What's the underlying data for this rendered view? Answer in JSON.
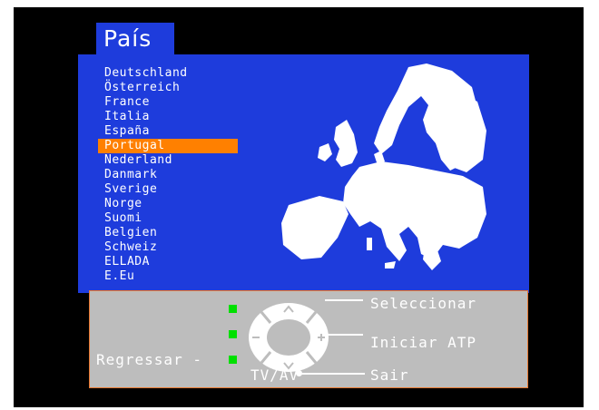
{
  "title": "País",
  "countries": [
    {
      "label": "Deutschland"
    },
    {
      "label": "Österreich"
    },
    {
      "label": "France"
    },
    {
      "label": "Italia"
    },
    {
      "label": "España"
    },
    {
      "label": "Portugal",
      "selected": true
    },
    {
      "label": "Nederland"
    },
    {
      "label": "Danmark"
    },
    {
      "label": "Sverige"
    },
    {
      "label": "Norge"
    },
    {
      "label": "Suomi"
    },
    {
      "label": "Belgien"
    },
    {
      "label": "Schweiz"
    },
    {
      "label": "ELLADA"
    },
    {
      "label": "E.Eu"
    }
  ],
  "controls": {
    "select_label": "Seleccionar",
    "start_label": "Iniciar ATP",
    "back_label": "Regressar -",
    "source_label": "TV/AV",
    "exit_label": "Sair",
    "dpad_up": "^",
    "dpad_down": "v",
    "dpad_left": "-",
    "dpad_right": "+"
  },
  "colors": {
    "panel_blue": "#1e3cdc",
    "highlight": "#ff8000",
    "control_grey": "#bdbdbd",
    "indicator_green": "#00e000"
  }
}
